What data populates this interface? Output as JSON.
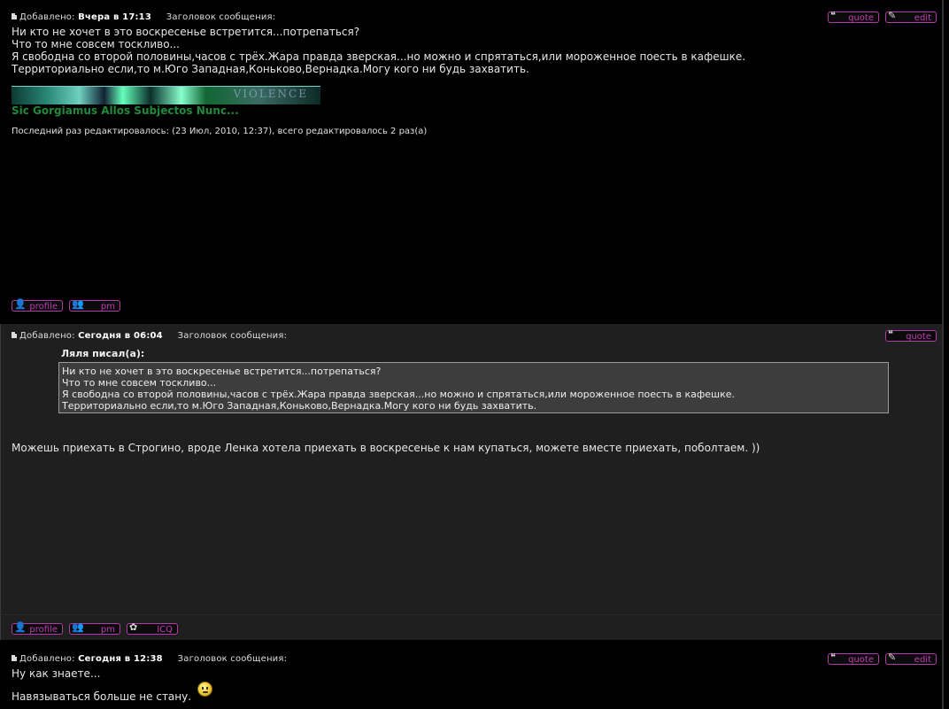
{
  "colors": {
    "background": "#000000",
    "alt_post_background": "#1f1f1f",
    "button_accent": "#c23cb7",
    "signature": "#1f8b3a",
    "quote_box": "#3d3d3d"
  },
  "posts": [
    {
      "added_label": "Добавлено:",
      "added_time": "Вчера в 17:13",
      "subject_label": "Заголовок сообщения:",
      "body_lines": [
        "Ни кто не хочет в это воскресенье встретится...потрепаться?",
        "Что то мне совсем тоскливо...",
        "Я свободна со второй половины,часов с трёх.Жара правда зверская...но можно и спрятаться,или мороженное поесть в кафешке.",
        "Территориально если,то м.Юго Западная,Коньково,Вернадка.Могу кого ни будь захватить."
      ],
      "signature_banner_text": "VIOLENCE",
      "signature_text": "Sic Gorgiamus Allos Subjectos Nunc...",
      "edit_note": "Последний раз редактировалось: (23 Июл, 2010, 12:37), всего редактировалось 2 раз(а)",
      "buttons": {
        "quote": "quote",
        "edit": "edit",
        "profile": "profile",
        "pm": "pm"
      }
    },
    {
      "added_label": "Добавлено:",
      "added_time": "Сегодня в 06:04",
      "subject_label": "Заголовок сообщения:",
      "quote_author": "Ляля писал(а):",
      "quote_lines": [
        "Ни кто не хочет в это воскресенье встретится...потрепаться?",
        "Что то мне совсем тоскливо...",
        "Я свободна со второй половины,часов с трёх.Жара правда зверская...но можно и спрятаться,или мороженное поесть в кафешке.",
        "Территориально если,то м.Юго Западная,Коньково,Вернадка.Могу кого ни будь захватить."
      ],
      "body": "Можешь приехать в Строгино, вроде Ленка хотела приехать в воскресенье к нам купаться, можете вместе приехать, поболтаем. ))",
      "buttons": {
        "quote": "quote",
        "profile": "profile",
        "pm": "pm",
        "icq": "ICQ"
      }
    },
    {
      "added_label": "Добавлено:",
      "added_time": "Сегодня в 12:38",
      "subject_label": "Заголовок сообщения:",
      "body_lines": [
        "Ну как знаете...",
        "Навязываться больше не стану."
      ],
      "smiley_icon": "smiley-icon",
      "buttons": {
        "quote": "quote",
        "edit": "edit"
      }
    }
  ]
}
